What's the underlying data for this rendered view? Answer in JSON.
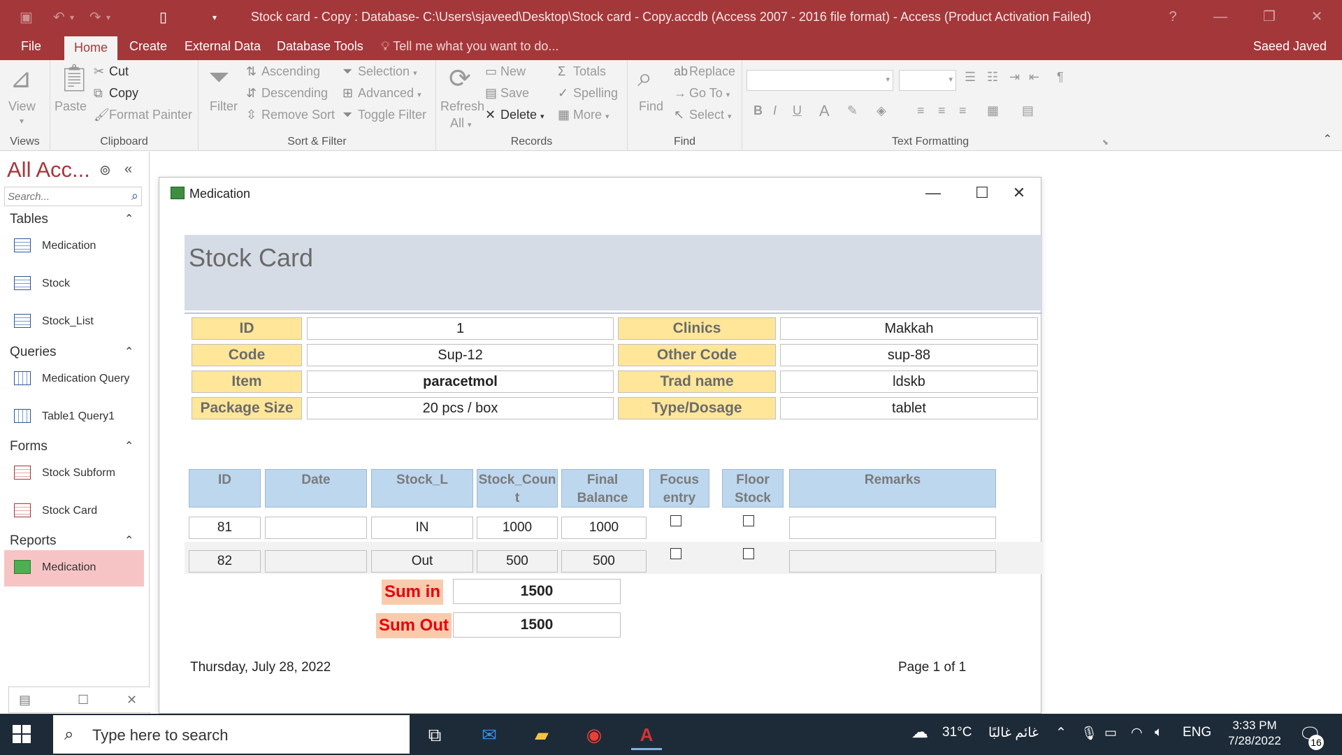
{
  "titlebar": {
    "title": "Stock card - Copy : Database- C:\\Users\\sjaveed\\Desktop\\Stock card - Copy.accdb (Access 2007 - 2016 file format) - Access (Product Activation Failed)",
    "help": "?",
    "minimize": "—",
    "restore": "❐",
    "close": "✕"
  },
  "menu": {
    "tabs": [
      "File",
      "Home",
      "Create",
      "External Data",
      "Database Tools"
    ],
    "tell_me": "Tell me what you want to do...",
    "user": "Saeed Javed"
  },
  "ribbon": {
    "views": {
      "view": "View",
      "label": "Views"
    },
    "clipboard": {
      "paste": "Paste",
      "cut": "Cut",
      "copy": "Copy",
      "format_painter": "Format Painter",
      "label": "Clipboard"
    },
    "sort_filter": {
      "filter": "Filter",
      "ascending": "Ascending",
      "descending": "Descending",
      "remove_sort": "Remove Sort",
      "selection": "Selection",
      "advanced": "Advanced",
      "toggle_filter": "Toggle Filter",
      "label": "Sort & Filter"
    },
    "records": {
      "refresh": "Refresh",
      "refresh_all": "All",
      "new": "New",
      "save": "Save",
      "delete": "Delete",
      "totals": "Totals",
      "spelling": "Spelling",
      "more": "More",
      "label": "Records"
    },
    "find": {
      "find": "Find",
      "replace": "Replace",
      "goto": "Go To",
      "select": "Select",
      "label": "Find"
    },
    "text_formatting": {
      "label": "Text Formatting",
      "bold": "B",
      "italic": "I",
      "underline": "U",
      "font_color": "A"
    }
  },
  "nav": {
    "title": "All Acc...",
    "search_placeholder": "Search...",
    "sections": {
      "tables": "Tables",
      "queries": "Queries",
      "forms": "Forms",
      "reports": "Reports"
    },
    "tables": [
      "Medication",
      "Stock",
      "Stock_List"
    ],
    "queries": [
      "Medication Query",
      "Table1 Query1"
    ],
    "forms": [
      "Stock  Subform",
      "Stock Card"
    ],
    "reports": [
      "Medication"
    ]
  },
  "report": {
    "window_title": "Medication",
    "header_title": "Stock Card",
    "fields": {
      "id_label": "ID",
      "id_value": "1",
      "clinics_label": "Clinics",
      "clinics_value": "Makkah",
      "code_label": "Code",
      "code_value": "Sup-12",
      "other_code_label": "Other Code",
      "other_code_value": "sup-88",
      "item_label": "Item",
      "item_value": "paracetmol",
      "trad_label": "Trad name",
      "trad_value": "ldskb",
      "package_label": "Package Size",
      "package_value": "20 pcs / box",
      "type_label": "Type/Dosage",
      "type_value": "tablet"
    },
    "columns": {
      "id": "ID",
      "date": "Date",
      "stock_l": "Stock_L",
      "stock_count": "Stock_Coun t",
      "final_balance": "Final Balance",
      "focus_entry": "Focus entry",
      "floor_stock": "Floor Stock",
      "remarks": "Remarks"
    },
    "rows": [
      {
        "id": "81",
        "date": "",
        "stock_l": "IN",
        "stock_count": "1000",
        "final_balance": "1000",
        "remarks": ""
      },
      {
        "id": "82",
        "date": "",
        "stock_l": "Out",
        "stock_count": "500",
        "final_balance": "500",
        "remarks": ""
      }
    ],
    "sum_in_label": "Sum in",
    "sum_in_value": "1500",
    "sum_out_label": "Sum Out",
    "sum_out_value": "1500",
    "footer_date": "Thursday, July 28, 2022",
    "footer_page": "Page 1 of 1"
  },
  "taskbar": {
    "search_text": "Type here to search",
    "weather_temp": "31°C",
    "weather_text": "غائم غالبًا",
    "lang": "ENG",
    "time": "3:33 PM",
    "date": "7/28/2022",
    "notifications": "16"
  },
  "colors": {
    "access_red": "#a4373a",
    "label_yellow": "#ffe699",
    "header_blue": "#bdd7ee",
    "sum_red": "#e8000b"
  }
}
